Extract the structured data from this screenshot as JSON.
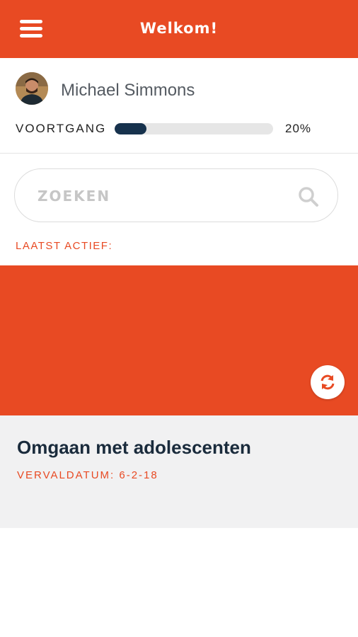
{
  "header": {
    "title": "Welkom!",
    "menu_icon": "hamburger-menu-icon"
  },
  "profile": {
    "name": "Michael Simmons",
    "avatar_icon": "user-avatar",
    "progress_label": "VOORTGANG",
    "progress_percent": 20,
    "progress_text": "20%"
  },
  "search": {
    "placeholder": "ZOEKEN",
    "icon": "search-icon"
  },
  "recent": {
    "label": "LAATST ACTIEF:"
  },
  "course": {
    "title": "Omgaan met adolescenten",
    "due": "VERVALDATUM: 6-2-18",
    "sync_icon": "refresh-icon"
  },
  "colors": {
    "accent": "#e84a23",
    "progress_fill": "#17324d",
    "card_background": "#f1f1f2"
  }
}
